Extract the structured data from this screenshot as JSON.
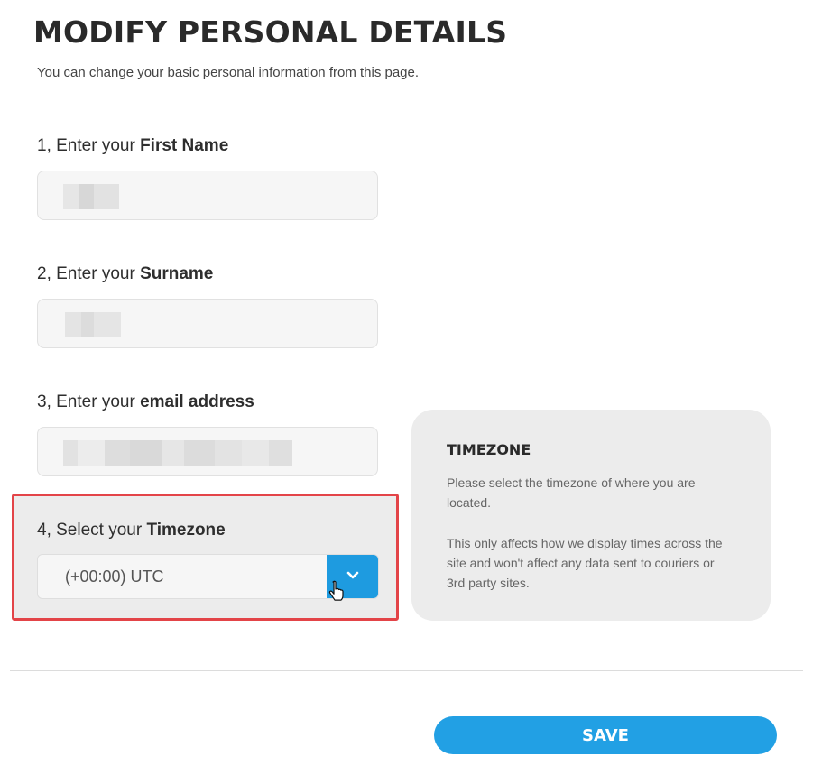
{
  "header": {
    "title": "MODIFY PERSONAL DETAILS",
    "subtitle": "You can change your basic personal information from this page."
  },
  "fields": {
    "first_name": {
      "prefix": "1, Enter your ",
      "label": "First Name"
    },
    "surname": {
      "prefix": "2, Enter your ",
      "label": "Surname"
    },
    "email": {
      "prefix": "3, Enter your ",
      "label": "email address"
    },
    "timezone": {
      "prefix": "4, Select your ",
      "label": "Timezone",
      "value": "(+00:00) UTC"
    }
  },
  "info_panel": {
    "title": "TIMEZONE",
    "paragraph_1": "Please select the timezone of where you are located.",
    "paragraph_2": "This only affects how we display times across the site and won't affect any data sent to couriers or 3rd party sites."
  },
  "actions": {
    "save_label": "SAVE"
  },
  "icons": {
    "dropdown": "chevron-down-icon",
    "cursor": "hand-pointer-icon"
  },
  "colors": {
    "accent": "#22a0e4",
    "highlight": "#e34448"
  }
}
